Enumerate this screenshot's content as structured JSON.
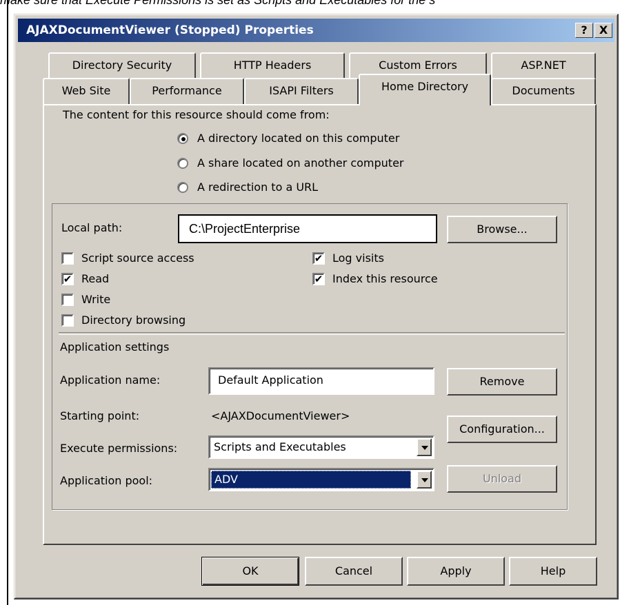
{
  "doc": {
    "line": "make sure that Execute Permissions is set as Scripts and Executables for the s"
  },
  "window": {
    "title": "AJAXDocumentViewer (Stopped) Properties",
    "help_btn": "?",
    "close_btn": "X"
  },
  "tabs_row1": [
    "Directory Security",
    "HTTP Headers",
    "Custom Errors",
    "ASP.NET"
  ],
  "tabs_row2": [
    "Web Site",
    "Performance",
    "ISAPI Filters",
    "Home Directory",
    "Documents"
  ],
  "content": {
    "source_label": "The content for this resource should come from:",
    "radio_directory": "A directory located on this computer",
    "radio_share": "A share located on another computer",
    "radio_redirect": "A redirection to a URL",
    "local_path_label": "Local path:",
    "local_path_value": "C:\\ProjectEnterprise",
    "browse_btn": "Browse...",
    "chk_script_source": "Script source access",
    "chk_read": "Read",
    "chk_write": "Write",
    "chk_dir_browsing": "Directory browsing",
    "chk_log_visits": "Log visits",
    "chk_index": "Index this resource",
    "app_settings_label": "Application settings",
    "app_name_label": "Application name:",
    "app_name_value": "Default Application",
    "remove_btn": "Remove",
    "starting_point_label": "Starting point:",
    "starting_point_value": "<AJAXDocumentViewer>",
    "config_btn": "Configuration...",
    "exec_perm_label": "Execute permissions:",
    "exec_perm_value": "Scripts and Executables",
    "app_pool_label": "Application pool:",
    "app_pool_value": "ADV",
    "unload_btn": "Unload"
  },
  "footer": {
    "ok": "OK",
    "cancel": "Cancel",
    "apply": "Apply",
    "help": "Help"
  },
  "state": {
    "radio_selected": "A directory located on this computer",
    "checked": [
      "Read",
      "Log visits",
      "Index this resource"
    ]
  },
  "colors": {
    "titlebar": "#0a246a",
    "face": "#d4d0c8",
    "selection": "#0a246a"
  }
}
